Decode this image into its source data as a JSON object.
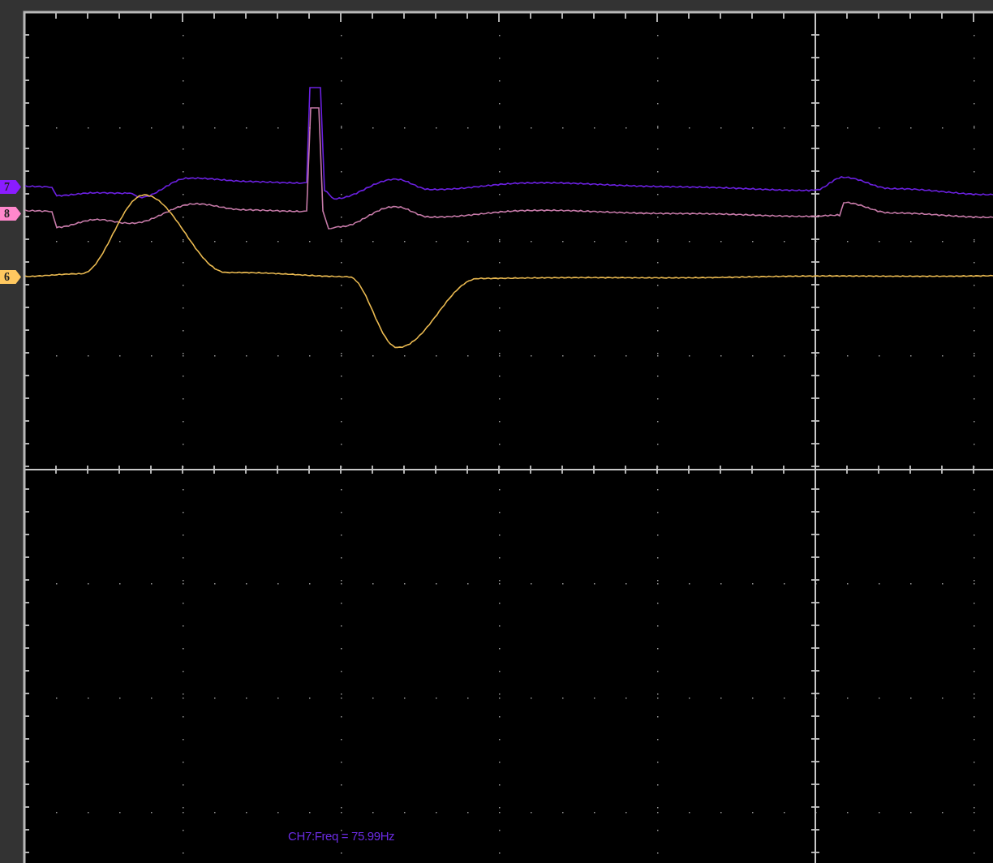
{
  "channel_markers": [
    {
      "label": "7",
      "color": "#8a1cff"
    },
    {
      "label": "8",
      "color": "#ff88cc"
    },
    {
      "label": "6",
      "color": "#ffc860"
    }
  ],
  "measurement": "CH7:Freq = 75.99Hz"
}
